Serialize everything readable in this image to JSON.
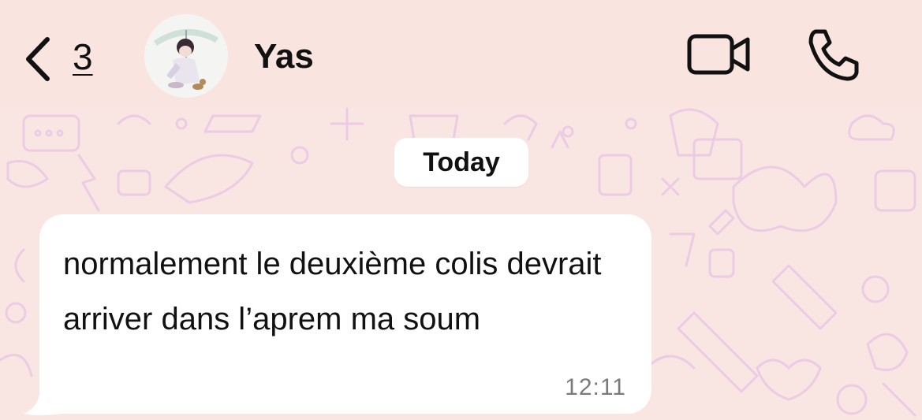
{
  "header": {
    "back_count": "3",
    "contact_name": "Yas",
    "icons": {
      "back": "chevron-left-icon",
      "video": "video-camera-icon",
      "call": "phone-icon"
    }
  },
  "chat": {
    "date_separator": "Today",
    "messages": [
      {
        "text": "normalement le deuxième colis devrait arriver dans l’aprem ma soum",
        "time": "12:11",
        "direction": "incoming"
      }
    ]
  },
  "colors": {
    "header_background": "#f9e4df",
    "chat_background": "#f9e6e2",
    "wallpaper_doodle": "#e9c8e6",
    "bubble": "#ffffff",
    "text": "#111111",
    "timestamp": "#7a7a7a"
  }
}
